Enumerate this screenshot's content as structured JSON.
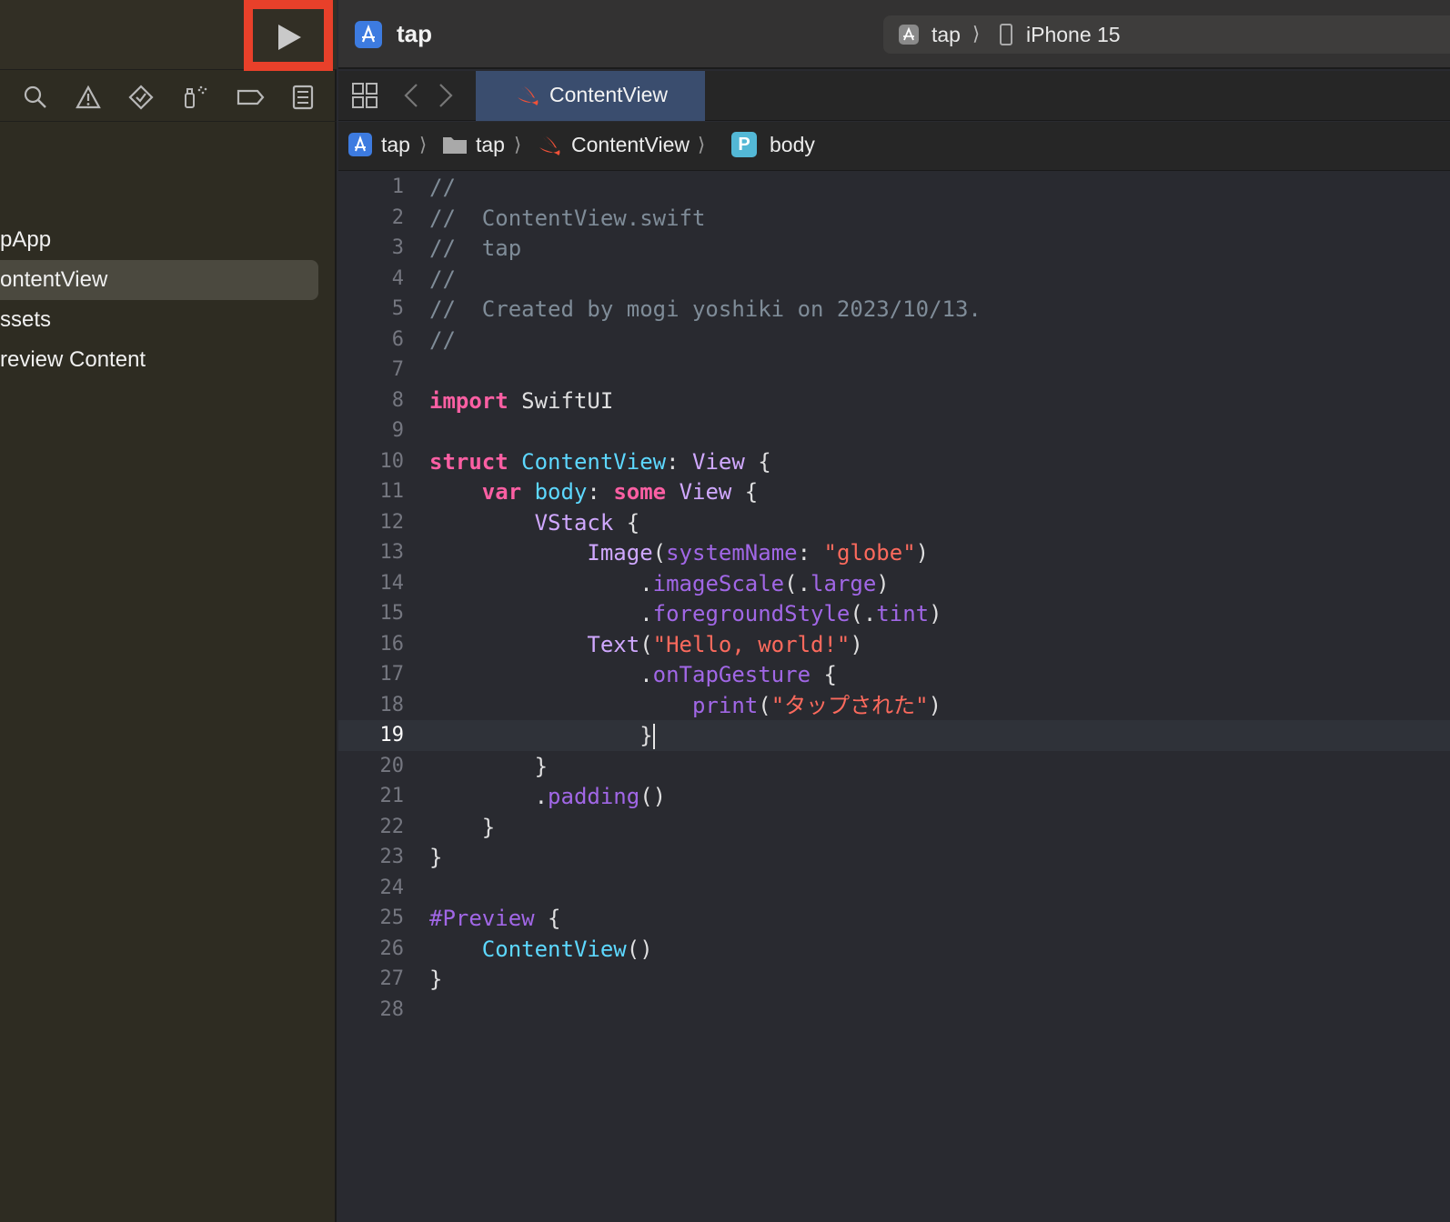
{
  "toolbar": {
    "run_icon": "play-icon",
    "project_title": "tap",
    "scheme_target": "tap",
    "scheme_separator": "⟩",
    "scheme_device": "iPhone 15",
    "highlight_color": "#e8402a"
  },
  "navigator": {
    "icons": [
      "search-icon",
      "warning-icon",
      "diamond-icon",
      "debug-icon",
      "tag-icon",
      "report-icon"
    ],
    "items": [
      {
        "label": "pApp"
      },
      {
        "label": "ontentView",
        "selected": true
      },
      {
        "label": "ssets"
      },
      {
        "label": "review Content"
      }
    ]
  },
  "tabs": [
    {
      "label": "ContentView",
      "icon": "swift-icon",
      "active": true
    }
  ],
  "breadcrumb": {
    "items": [
      "tap",
      "tap",
      "ContentView",
      "body"
    ],
    "separator": "⟩",
    "symbol_badge": "P"
  },
  "editor": {
    "current_line": 19,
    "line_numbers": [
      "1",
      "2",
      "3",
      "4",
      "5",
      "6",
      "7",
      "8",
      "9",
      "10",
      "11",
      "12",
      "13",
      "14",
      "15",
      "16",
      "17",
      "18",
      "19",
      "20",
      "21",
      "22",
      "23",
      "24",
      "25",
      "26",
      "27",
      "28"
    ],
    "lines": [
      [
        {
          "t": "//",
          "c": "cm"
        }
      ],
      [
        {
          "t": "//  ContentView.swift",
          "c": "cm"
        }
      ],
      [
        {
          "t": "//  tap",
          "c": "cm"
        }
      ],
      [
        {
          "t": "//",
          "c": "cm"
        }
      ],
      [
        {
          "t": "//  Created by mogi yoshiki on 2023/10/13.",
          "c": "cm"
        }
      ],
      [
        {
          "t": "//",
          "c": "cm"
        }
      ],
      [],
      [
        {
          "t": "import",
          "c": "kw"
        },
        {
          "t": " SwiftUI",
          "c": "pl"
        }
      ],
      [],
      [
        {
          "t": "struct",
          "c": "kw"
        },
        {
          "t": " ",
          "c": "pl"
        },
        {
          "t": "ContentView",
          "c": "decl"
        },
        {
          "t": ": ",
          "c": "pl"
        },
        {
          "t": "View",
          "c": "ty"
        },
        {
          "t": " {",
          "c": "pl"
        }
      ],
      [
        {
          "t": "    ",
          "c": "pl"
        },
        {
          "t": "var",
          "c": "kw"
        },
        {
          "t": " ",
          "c": "pl"
        },
        {
          "t": "body",
          "c": "decl"
        },
        {
          "t": ": ",
          "c": "pl"
        },
        {
          "t": "some",
          "c": "kw"
        },
        {
          "t": " ",
          "c": "pl"
        },
        {
          "t": "View",
          "c": "ty"
        },
        {
          "t": " {",
          "c": "pl"
        }
      ],
      [
        {
          "t": "        ",
          "c": "pl"
        },
        {
          "t": "VStack",
          "c": "ty"
        },
        {
          "t": " {",
          "c": "pl"
        }
      ],
      [
        {
          "t": "            ",
          "c": "pl"
        },
        {
          "t": "Image",
          "c": "ty"
        },
        {
          "t": "(",
          "c": "pl"
        },
        {
          "t": "systemName",
          "c": "fn"
        },
        {
          "t": ": ",
          "c": "pl"
        },
        {
          "t": "\"globe\"",
          "c": "str"
        },
        {
          "t": ")",
          "c": "pl"
        }
      ],
      [
        {
          "t": "                .",
          "c": "pl"
        },
        {
          "t": "imageScale",
          "c": "fn"
        },
        {
          "t": "(.",
          "c": "pl"
        },
        {
          "t": "large",
          "c": "fn"
        },
        {
          "t": ")",
          "c": "pl"
        }
      ],
      [
        {
          "t": "                .",
          "c": "pl"
        },
        {
          "t": "foregroundStyle",
          "c": "fn"
        },
        {
          "t": "(.",
          "c": "pl"
        },
        {
          "t": "tint",
          "c": "fn"
        },
        {
          "t": ")",
          "c": "pl"
        }
      ],
      [
        {
          "t": "            ",
          "c": "pl"
        },
        {
          "t": "Text",
          "c": "ty"
        },
        {
          "t": "(",
          "c": "pl"
        },
        {
          "t": "\"Hello, world!\"",
          "c": "str"
        },
        {
          "t": ")",
          "c": "pl"
        }
      ],
      [
        {
          "t": "                .",
          "c": "pl"
        },
        {
          "t": "onTapGesture",
          "c": "fn"
        },
        {
          "t": " {",
          "c": "pl"
        }
      ],
      [
        {
          "t": "                    ",
          "c": "pl"
        },
        {
          "t": "print",
          "c": "fn"
        },
        {
          "t": "(",
          "c": "pl"
        },
        {
          "t": "\"タップされた\"",
          "c": "str"
        },
        {
          "t": ")",
          "c": "pl"
        }
      ],
      [
        {
          "t": "                }",
          "c": "pl"
        },
        {
          "t": "",
          "c": "cursor"
        }
      ],
      [
        {
          "t": "        }",
          "c": "pl"
        }
      ],
      [
        {
          "t": "        .",
          "c": "pl"
        },
        {
          "t": "padding",
          "c": "fn"
        },
        {
          "t": "()",
          "c": "pl"
        }
      ],
      [
        {
          "t": "    }",
          "c": "pl"
        }
      ],
      [
        {
          "t": "}",
          "c": "pl"
        }
      ],
      [],
      [
        {
          "t": "#Preview",
          "c": "fn"
        },
        {
          "t": " {",
          "c": "pl"
        }
      ],
      [
        {
          "t": "    ",
          "c": "pl"
        },
        {
          "t": "ContentView",
          "c": "decl"
        },
        {
          "t": "()",
          "c": "pl"
        }
      ],
      [
        {
          "t": "}",
          "c": "pl"
        }
      ],
      []
    ]
  }
}
